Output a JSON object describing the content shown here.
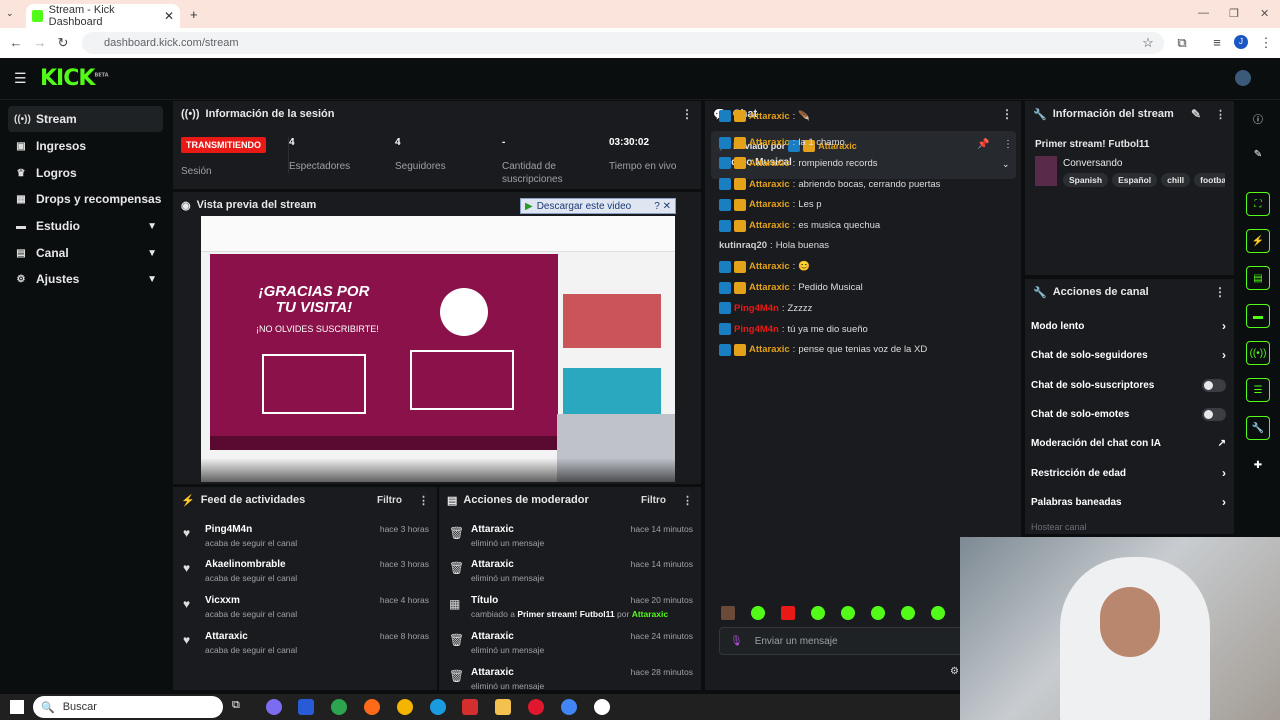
{
  "browser": {
    "tab_title": "Stream - Kick Dashboard",
    "url": "dashboard.kick.com/stream",
    "profile_initial": "J"
  },
  "brand": {
    "logo": "KICK",
    "beta": "BETA",
    "accent": "#53fc18"
  },
  "sidebar": {
    "items": [
      {
        "label": "Stream",
        "icon": "stream-icon"
      },
      {
        "label": "Ingresos",
        "icon": "money-icon"
      },
      {
        "label": "Logros",
        "icon": "trophy-icon"
      },
      {
        "label": "Drops y recompensas",
        "icon": "gift-icon"
      },
      {
        "label": "Estudio",
        "icon": "studio-icon"
      },
      {
        "label": "Canal",
        "icon": "channel-icon"
      },
      {
        "label": "Ajustes",
        "icon": "gear-icon"
      }
    ]
  },
  "session": {
    "title": "Información de la sesión",
    "live": "TRANSMITIENDO",
    "live_label": "Sesión",
    "stats": [
      {
        "value": "4",
        "label": "Espectadores"
      },
      {
        "value": "4",
        "label": "Seguidores"
      },
      {
        "value": "-",
        "label": "Cantidad de suscripciones"
      },
      {
        "value": "03:30:02",
        "label": "Tiempo en vivo"
      }
    ]
  },
  "preview": {
    "title": "Vista previa del stream",
    "download_label": "Descargar este video",
    "slide_title": "¡GRACIAS POR TU VISITA!",
    "slide_sub": "¡NO OLVIDES SUSCRIBIRTE!"
  },
  "chat": {
    "title": "Chat",
    "pinned_by": "Enviado por",
    "pinned_user": "Attaraxic",
    "pinned_text": "Pedido Musical",
    "input_placeholder": "Enviar un mensaje",
    "messages": [
      {
        "user": "Attaraxic",
        "text": "🪶",
        "color": "#e3a21a",
        "badges": 2
      },
      {
        "user": "Attaraxic",
        "text": "la 1 chamo",
        "color": "#e3a21a",
        "badges": 2
      },
      {
        "user": "Attaraxic",
        "text": "rompiendo records",
        "color": "#e3a21a",
        "badges": 2
      },
      {
        "user": "Attaraxic",
        "text": "abriendo bocas, cerrando puertas",
        "color": "#e3a21a",
        "badges": 2
      },
      {
        "user": "Attaraxic",
        "text": "Les p",
        "color": "#e3a21a",
        "badges": 2
      },
      {
        "user": "Attaraxic",
        "text": "es musica quechua",
        "color": "#e3a21a",
        "badges": 2
      },
      {
        "user": "kutinraq20",
        "text": "Hola buenas",
        "color": "#cfcfcf",
        "badges": 0
      },
      {
        "user": "Attaraxic",
        "text": "😊",
        "color": "#e3a21a",
        "badges": 2
      },
      {
        "user": "Attaraxic",
        "text": "Pedido Musical",
        "color": "#e3a21a",
        "badges": 2
      },
      {
        "user": "Ping4M4n",
        "text": "Zzzzz",
        "color": "#e91916",
        "badges": 1
      },
      {
        "user": "Ping4M4n",
        "text": "tú ya me dio sueño",
        "color": "#e91916",
        "badges": 1
      },
      {
        "user": "Attaraxic",
        "text": "pense que tenias voz de la XD",
        "color": "#e3a21a",
        "badges": 2
      }
    ]
  },
  "stream_info": {
    "title": "Información del stream",
    "stream_name": "Primer stream! Futbol11",
    "category": "Conversando",
    "tags": [
      "Spanish",
      "Español",
      "chill",
      "footballs"
    ]
  },
  "channel_actions": {
    "title": "Acciones de canal",
    "items": [
      {
        "label": "Modo lento",
        "control": "chevron"
      },
      {
        "label": "Chat de solo-seguidores",
        "control": "chevron"
      },
      {
        "label": "Chat de solo-suscriptores",
        "control": "toggle"
      },
      {
        "label": "Chat de solo-emotes",
        "control": "toggle"
      },
      {
        "label": "Moderación del chat con IA",
        "control": "external"
      },
      {
        "label": "Restricción de edad",
        "control": "chevron"
      },
      {
        "label": "Palabras baneadas",
        "control": "chevron"
      }
    ],
    "host_label": "Hostear canal"
  },
  "activity": {
    "title": "Feed de actividades",
    "filter": "Filtro",
    "items": [
      {
        "name": "Ping4M4n",
        "sub": "acaba de seguir el canal",
        "time": "hace 3 horas"
      },
      {
        "name": "Akaelinombrable",
        "sub": "acaba de seguir el canal",
        "time": "hace 3 horas"
      },
      {
        "name": "Vicxxm",
        "sub": "acaba de seguir el canal",
        "time": "hace 4 horas"
      },
      {
        "name": "Attaraxic",
        "sub": "acaba de seguir el canal",
        "time": "hace 8 horas"
      }
    ]
  },
  "modactions": {
    "title": "Acciones de moderador",
    "filter": "Filtro",
    "items": [
      {
        "name": "Attaraxic",
        "sub": "eliminó un mensaje",
        "time": "hace 14 minutos"
      },
      {
        "name": "Attaraxic",
        "sub": "eliminó un mensaje",
        "time": "hace 14 minutos"
      },
      {
        "name": "Título",
        "sub": "cambiado a",
        "sub2": "Primer stream! Futbol11",
        "sub3": "por",
        "sub4": "Attaraxic",
        "time": "hace 20 minutos"
      },
      {
        "name": "Attaraxic",
        "sub": "eliminó un mensaje",
        "time": "hace 24 minutos"
      },
      {
        "name": "Attaraxic",
        "sub": "eliminó un mensaje",
        "time": "hace 28 minutos"
      }
    ]
  },
  "taskbar": {
    "search": "Buscar"
  }
}
